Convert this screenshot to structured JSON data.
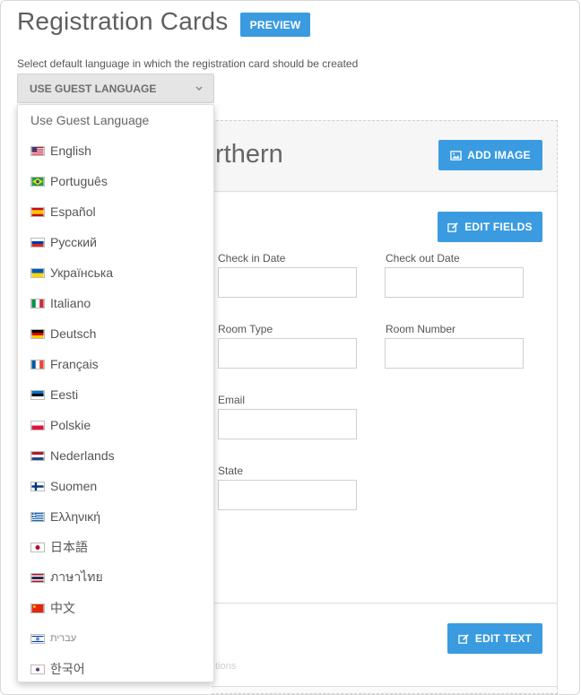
{
  "page": {
    "title": "Registration Cards",
    "preview_label": "PREVIEW",
    "hint": "Select default language in which the registration card should be created"
  },
  "language_select": {
    "selected": "USE GUEST LANGUAGE",
    "options": [
      {
        "label": "Use Guest Language",
        "flag": ""
      },
      {
        "label": "English",
        "flag": "us-flag"
      },
      {
        "label": "Português",
        "flag": "br-flag"
      },
      {
        "label": "Español",
        "flag": "es-flag"
      },
      {
        "label": "Русский",
        "flag": "ru-flag"
      },
      {
        "label": "Українська",
        "flag": "ua-flag"
      },
      {
        "label": "Italiano",
        "flag": "it-flag"
      },
      {
        "label": "Deutsch",
        "flag": "de-flag"
      },
      {
        "label": "Français",
        "flag": "fr-flag"
      },
      {
        "label": "Eesti",
        "flag": "ee-flag"
      },
      {
        "label": "Polskie",
        "flag": "pl-flag"
      },
      {
        "label": "Nederlands",
        "flag": "nl-flag"
      },
      {
        "label": "Suomen",
        "flag": "fi-flag"
      },
      {
        "label": "Ελληνική",
        "flag": "gr-flag"
      },
      {
        "label": "日本語",
        "flag": "jp-flag"
      },
      {
        "label": "ภาษาไทย",
        "flag": "th-flag"
      },
      {
        "label": "中文",
        "flag": "cn-flag"
      },
      {
        "label": "עברית",
        "flag": "il-flag"
      },
      {
        "label": "한국어",
        "flag": "kr-flag"
      }
    ]
  },
  "card": {
    "hotel_name_partial": "rthern",
    "add_image_label": "ADD IMAGE",
    "edit_fields_label": "EDIT FIELDS",
    "edit_text_label": "EDIT TEXT",
    "faint_text": "tions",
    "fields": {
      "check_in": "Check in Date",
      "check_out": "Check out Date",
      "room_type": "Room Type",
      "room_number": "Room Number",
      "email": "Email",
      "state": "State"
    }
  },
  "colors": {
    "accent": "#3a9be0"
  }
}
